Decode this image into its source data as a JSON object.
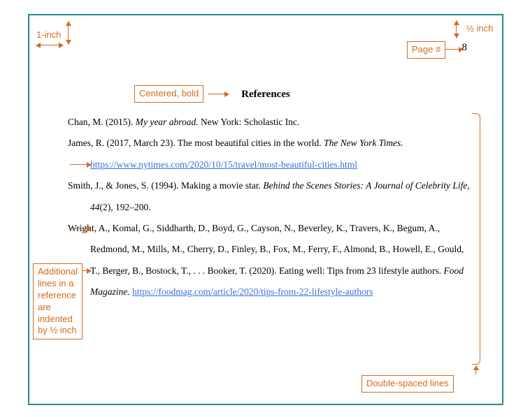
{
  "page_number": "8",
  "title": "References",
  "annotations": {
    "one_inch": "1-inch",
    "half_inch": "½ inch",
    "page_num_label": "Page #",
    "centered_bold": "Centered, bold",
    "hanging_indent": "Additional\nlines in a\nreference\nare\nindented\nby ½ inch",
    "double_spaced": "Double-spaced lines"
  },
  "references": {
    "r1_a": "Chan, M. (2015). ",
    "r1_i": "My year abroad.",
    "r1_b": " New York: Scholastic Inc.",
    "r2_a": "James, R. (2017, March 23). The most beautiful cities in the world. ",
    "r2_i": "The New York Times.",
    "r2_link": "https://www.nytimes.com/2020/10/15/travel/most-beautiful-cities.html",
    "r3_a": "Smith, J., & Jones, S. (1994). Making a movie star. ",
    "r3_i": "Behind the Scenes Stories: A Journal of Celebrity Life, 44",
    "r3_b": "(2), 192–200.",
    "r4_a": "Wright, A., Komal, G., Siddharth, D., Boyd, G., Cayson, N., Beverley, K., Travers, K., Begum, A., Redmond, M., Mills, M., Cherry, D., Finley, B., Fox, M., Ferry, F., Almond, B., Howell, E., Gould, T., Berger, B., Bostock, T., . . . Booker, T. (2020). Eating well: Tips from 23 lifestyle authors. ",
    "r4_i": "Food Magazine.",
    "r4_link": "https://foodmag.com/article/2020/tips-from-22-lifestyle-authors"
  }
}
